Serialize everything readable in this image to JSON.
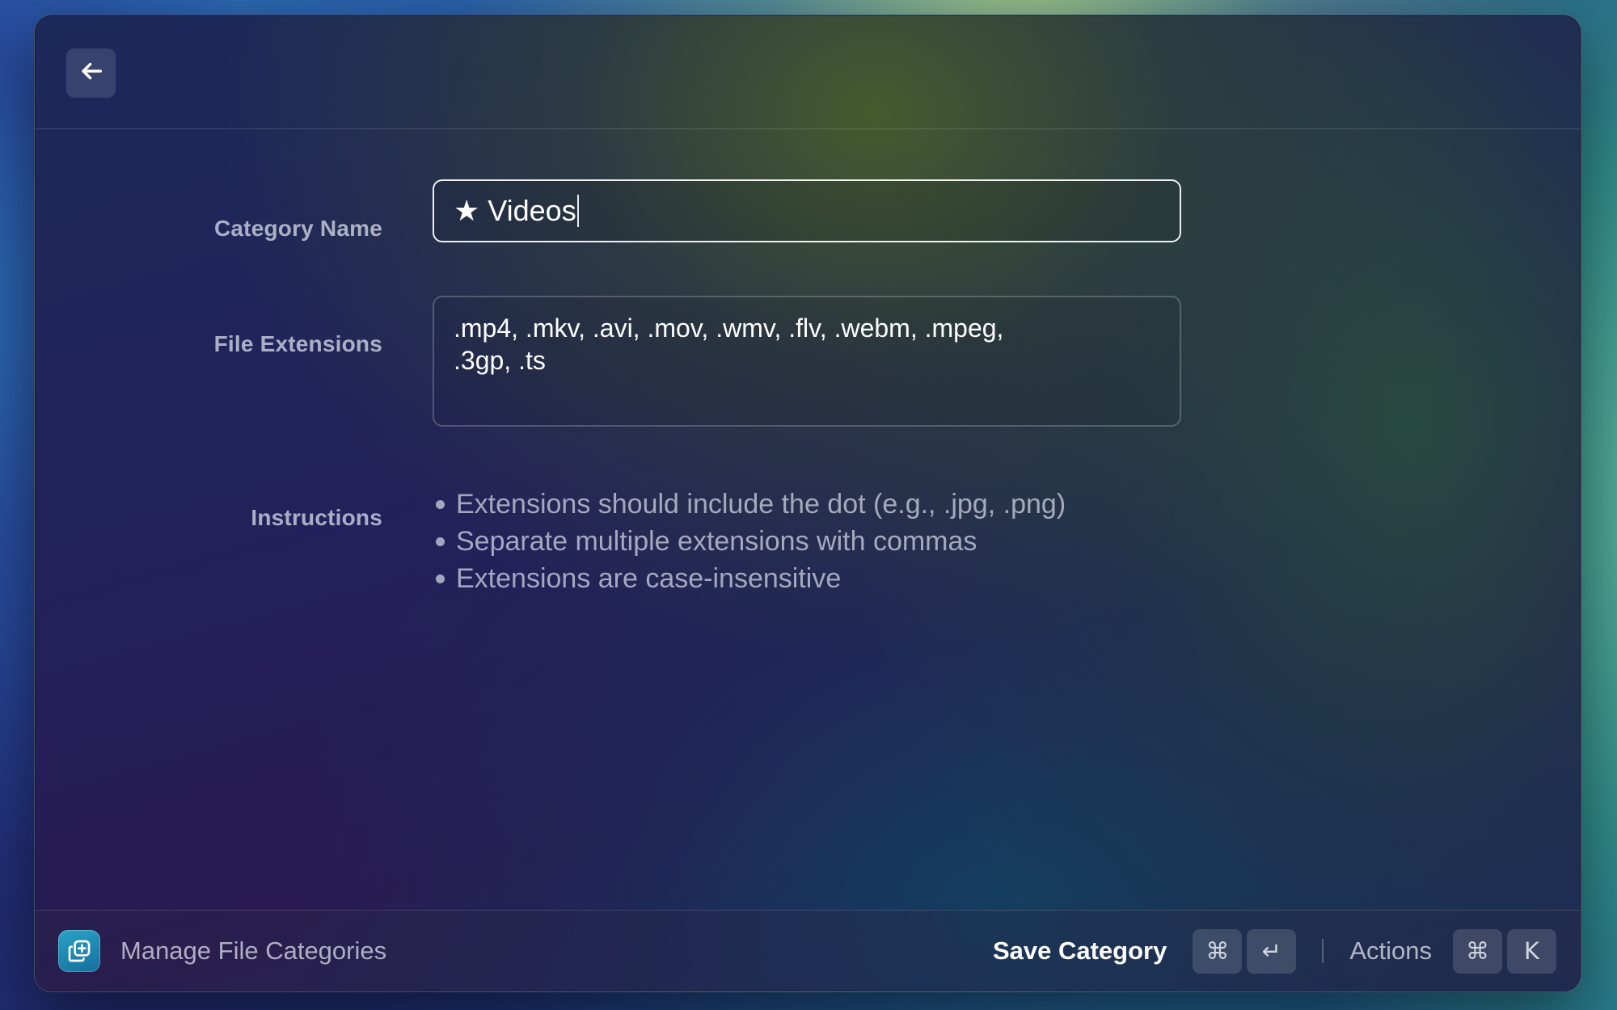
{
  "window": {
    "icons": {
      "back": "arrow-left-icon",
      "app": "category-add-icon"
    }
  },
  "form": {
    "category_name_label": "Category Name",
    "category_name_value": "★ Videos",
    "file_extensions_label": "File Extensions",
    "file_extensions_value": ".mp4, .mkv, .avi, .mov, .wmv, .flv, .webm, .mpeg,\n.3gp, .ts",
    "instructions_label": "Instructions",
    "instructions": [
      "Extensions should include the dot (e.g., .jpg, .png)",
      "Separate multiple extensions with commas",
      "Extensions are case-insensitive"
    ]
  },
  "footer": {
    "title": "Manage File Categories",
    "primary_action": "Save Category",
    "primary_shortcut": [
      "⌘",
      "↵"
    ],
    "secondary_action": "Actions",
    "secondary_shortcut": [
      "⌘",
      "K"
    ]
  },
  "colors": {
    "input_border_focused": "#ffffff",
    "app_icon": "#1f8fbd"
  }
}
